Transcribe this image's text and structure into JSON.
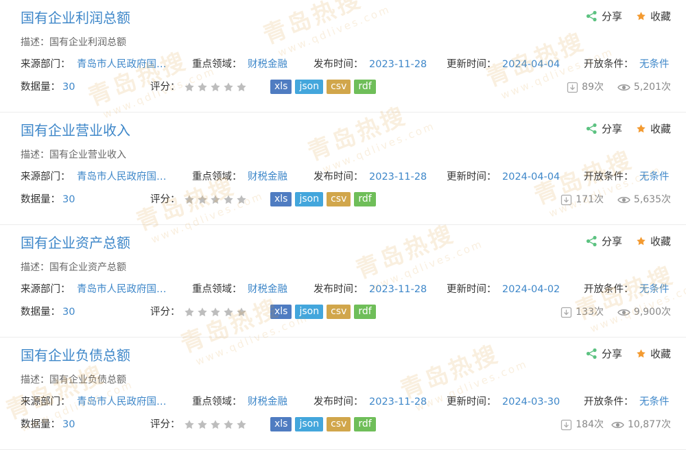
{
  "colors": {
    "link": "#3e87c9",
    "xls": "#4f7cc1",
    "json": "#43a6dc",
    "csv": "#d1a64b",
    "rdf": "#6fbe59",
    "share_icon": "#5cc281",
    "fav_icon": "#f39a30",
    "star_empty": "#bdbdbd"
  },
  "labels": {
    "share": "分享",
    "favorite": "收藏",
    "desc": "描述：",
    "source": "来源部门：",
    "domain": "重点领域：",
    "publish": "发布时间：",
    "update": "更新时间：",
    "open": "开放条件：",
    "count": "数据量：",
    "rating": "评分："
  },
  "icons": {
    "share": "share-icon",
    "favorite": "star-filled-icon",
    "download": "download-icon",
    "view": "eye-icon",
    "rating": "star-outline-icon"
  },
  "watermark": {
    "text_cn": "青岛热搜",
    "text_en": "www.qdlives.com"
  },
  "items": [
    {
      "title": "国有企业利润总额",
      "desc": "国有企业利润总额",
      "source": "青岛市人民政府国…",
      "domain": "财税金融",
      "publish": "2023-11-28",
      "update": "2024-04-04",
      "open": "无条件",
      "count": "30",
      "rating": 0,
      "formats": [
        "xls",
        "json",
        "csv",
        "rdf"
      ],
      "downloads": "89次",
      "views": "5,201次"
    },
    {
      "title": "国有企业营业收入",
      "desc": "国有企业营业收入",
      "source": "青岛市人民政府国…",
      "domain": "财税金融",
      "publish": "2023-11-28",
      "update": "2024-04-04",
      "open": "无条件",
      "count": "30",
      "rating": 0,
      "formats": [
        "xls",
        "json",
        "csv",
        "rdf"
      ],
      "downloads": "171次",
      "views": "5,635次"
    },
    {
      "title": "国有企业资产总额",
      "desc": "国有企业资产总额",
      "source": "青岛市人民政府国…",
      "domain": "财税金融",
      "publish": "2023-11-28",
      "update": "2024-04-02",
      "open": "无条件",
      "count": "30",
      "rating": 0,
      "formats": [
        "xls",
        "json",
        "csv",
        "rdf"
      ],
      "downloads": "133次",
      "views": "9,900次"
    },
    {
      "title": "国有企业负债总额",
      "desc": "国有企业负债总额",
      "source": "青岛市人民政府国…",
      "domain": "财税金融",
      "publish": "2023-11-28",
      "update": "2024-03-30",
      "open": "无条件",
      "count": "30",
      "rating": 0,
      "formats": [
        "xls",
        "json",
        "csv",
        "rdf"
      ],
      "downloads": "184次",
      "views": "10,877次"
    }
  ]
}
